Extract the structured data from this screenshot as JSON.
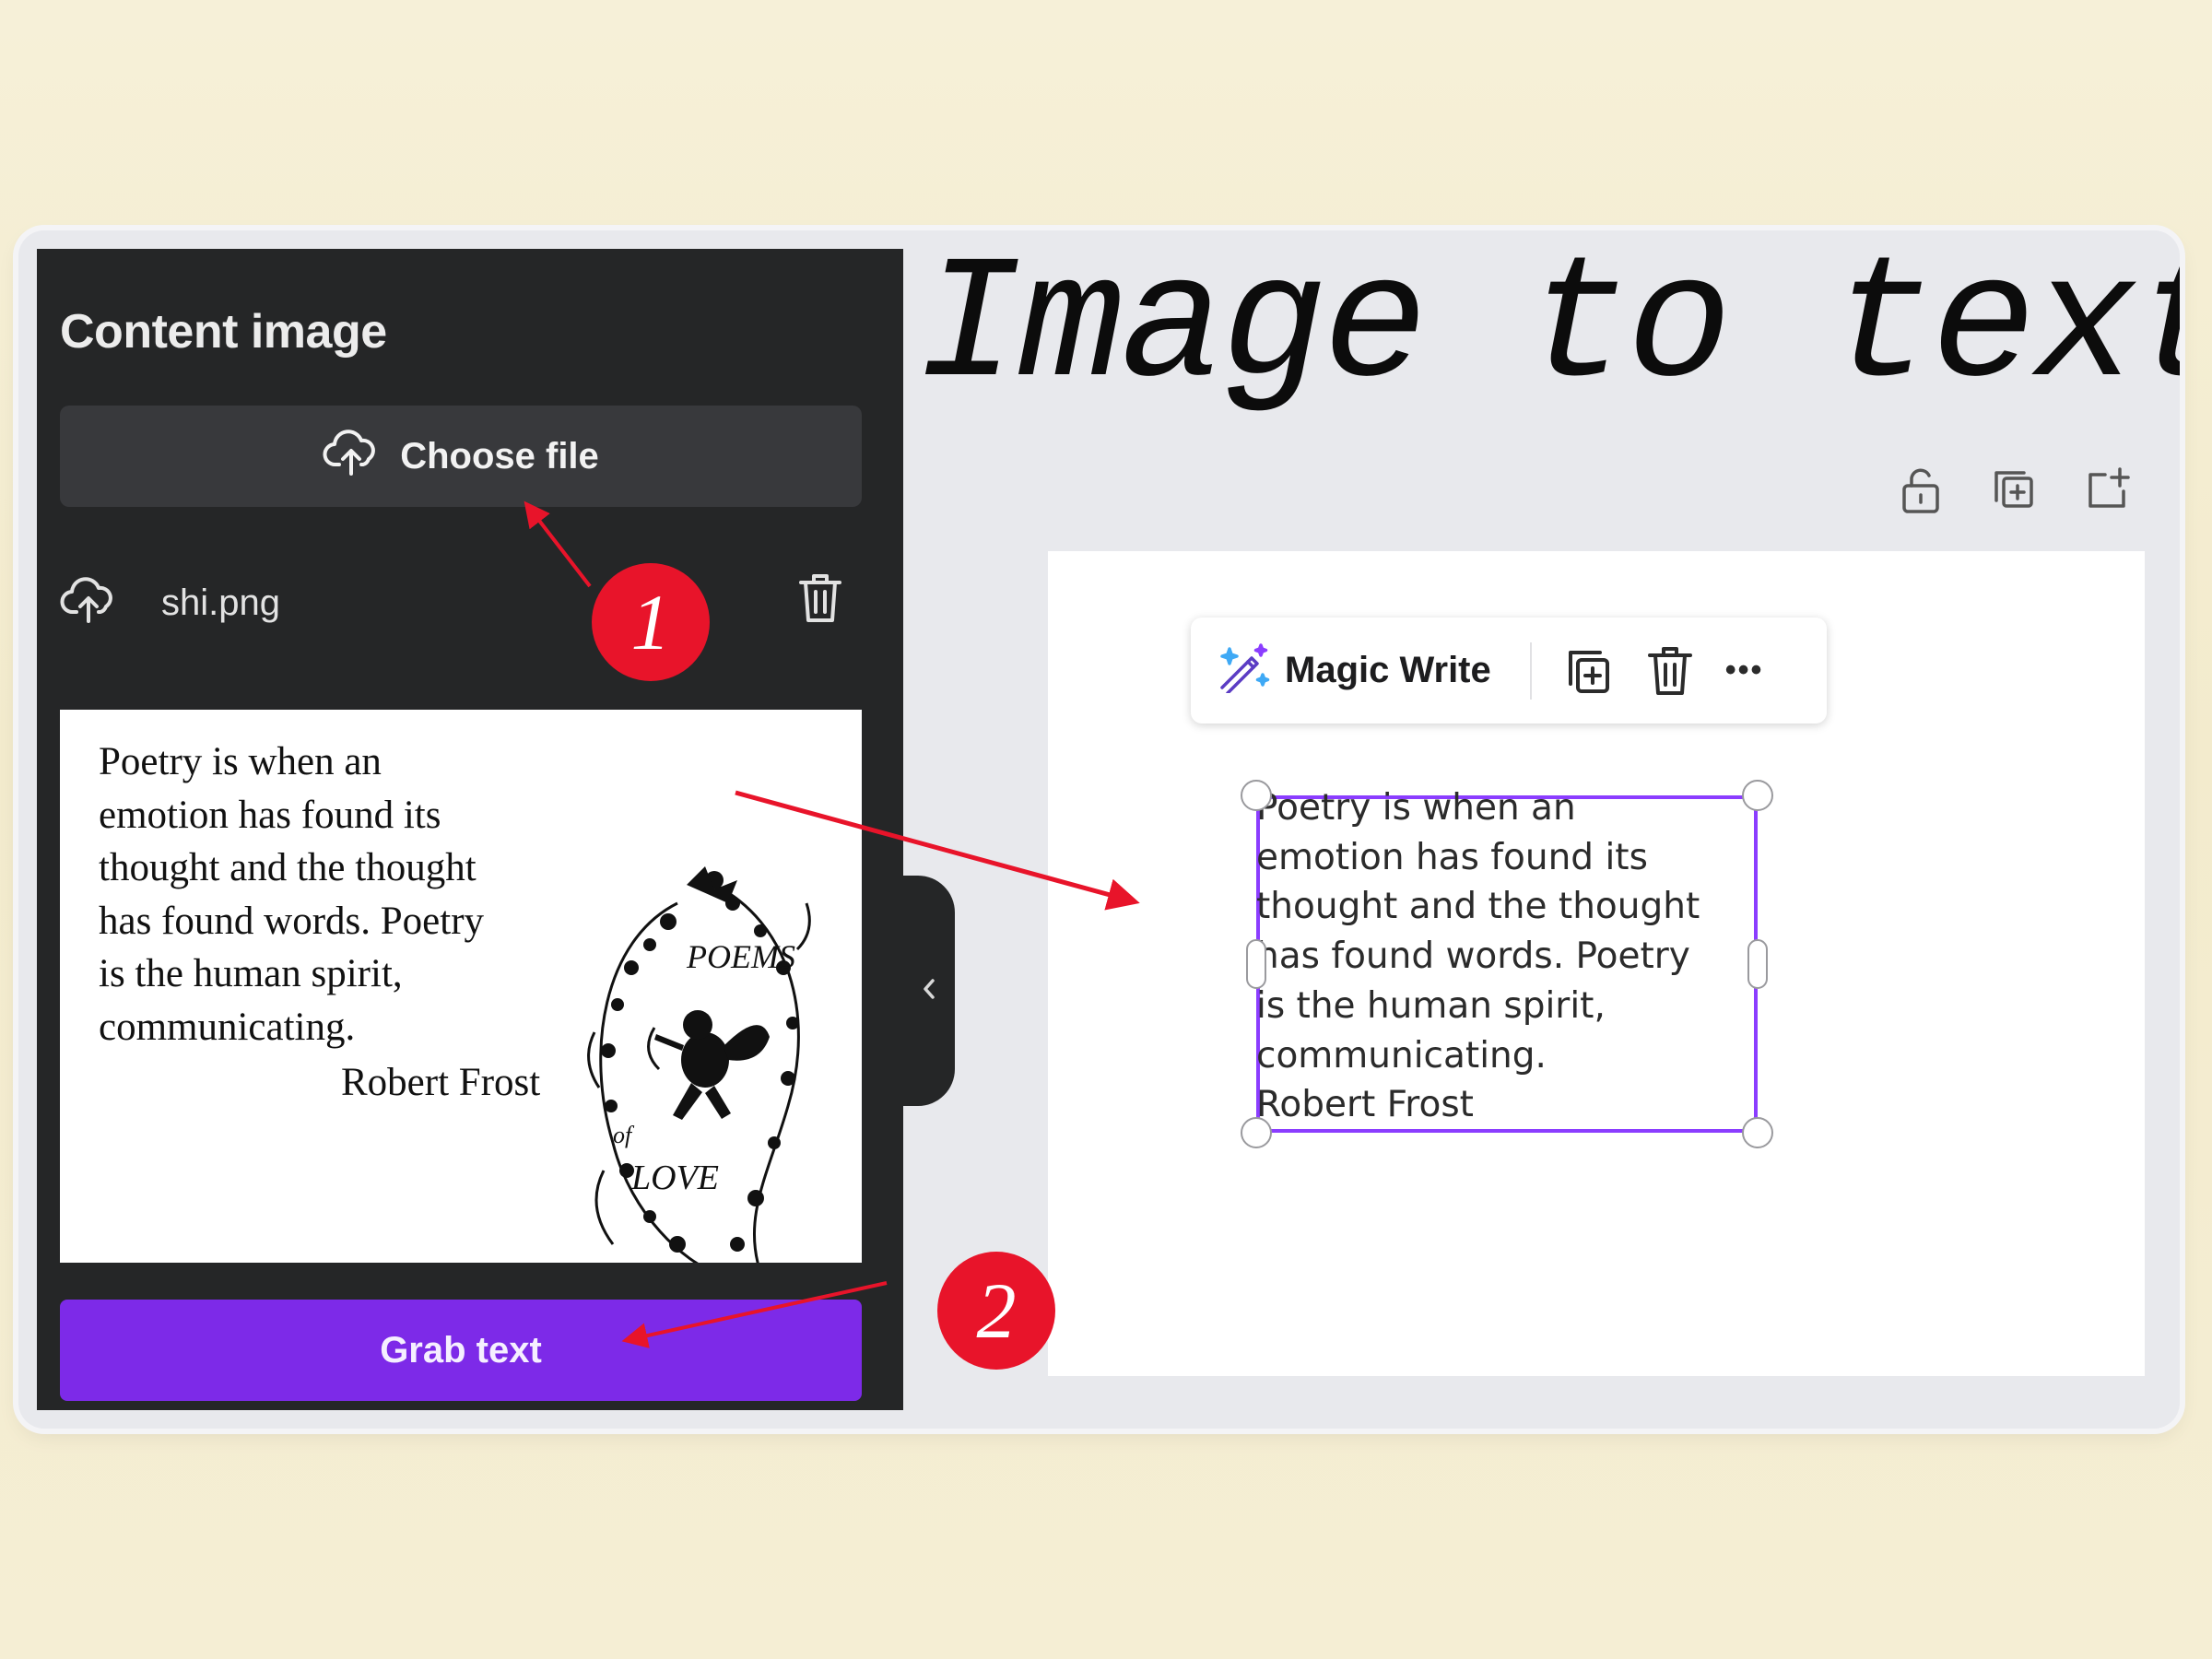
{
  "sidebar": {
    "title": "Content image",
    "choose_file_label": "Choose file",
    "file_name": "shi.png",
    "preview_lines": [
      "Poetry is when an",
      "emotion has found its",
      "thought and the thought",
      "has found words. Poetry",
      "is the human spirit,",
      "communicating."
    ],
    "preview_author": "Robert Frost",
    "grab_text_label": "Grab text"
  },
  "heading": "Image to text",
  "toolbar": {
    "magic_write_label": "Magic Write",
    "more_label": "•••"
  },
  "text_box": {
    "content": "Poetry is when an\nemotion has found its\nthought and the thought\nhas found words. Poetry\nis the human spirit,\ncommunicating.\nRobert Frost"
  },
  "annotations": {
    "step1": "1",
    "step2": "2"
  },
  "colors": {
    "panel_bg": "#252627",
    "accent_purple": "#7d2ae8",
    "selection_purple": "#8b3dff",
    "annotation_red": "#e8142a"
  },
  "icons": [
    "cloud-upload-icon",
    "trash-icon",
    "lock-icon",
    "duplicate-icon",
    "add-page-icon",
    "magic-wand-icon",
    "more-icon",
    "rotate-icon",
    "chevron-left-icon"
  ]
}
